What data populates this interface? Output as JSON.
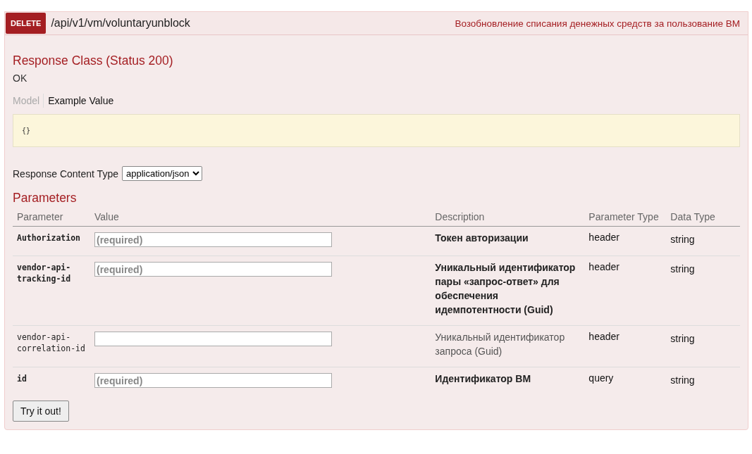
{
  "operation": {
    "method": "DELETE",
    "path": "/api/v1/vm/voluntaryunblock",
    "summary": "Возобновление списания денежных средств за пользование ВМ"
  },
  "response_class": {
    "title": "Response Class (Status 200)",
    "status_text": "OK",
    "tabs": [
      {
        "label": "Model",
        "selected": false
      },
      {
        "label": "Example Value",
        "selected": true
      }
    ],
    "example_value": "{}"
  },
  "response_content_type": {
    "label": "Response Content Type",
    "value": "application/json"
  },
  "parameters": {
    "title": "Parameters",
    "columns": [
      "Parameter",
      "Value",
      "Description",
      "Parameter Type",
      "Data Type"
    ],
    "rows": [
      {
        "name": "Authorization",
        "placeholder": "(required)",
        "required": true,
        "description": "Токен авторизации",
        "parameter_type": "header",
        "data_type": "string"
      },
      {
        "name": "vendor-api-tracking-id",
        "placeholder": "(required)",
        "required": true,
        "description": "Уникальный идентификатор пары «запрос-ответ» для обеспечения идемпотентности (Guid)",
        "parameter_type": "header",
        "data_type": "string"
      },
      {
        "name": "vendor-api-correlation-id",
        "required": false,
        "description": "Уникальный идентификатор запроса (Guid)",
        "parameter_type": "header",
        "data_type": "string"
      },
      {
        "name": "id",
        "placeholder": "(required)",
        "required": true,
        "description": "Идентификатор ВМ",
        "parameter_type": "query",
        "data_type": "string"
      }
    ]
  },
  "buttons": [
    {
      "label": "Try it out!"
    }
  ]
}
